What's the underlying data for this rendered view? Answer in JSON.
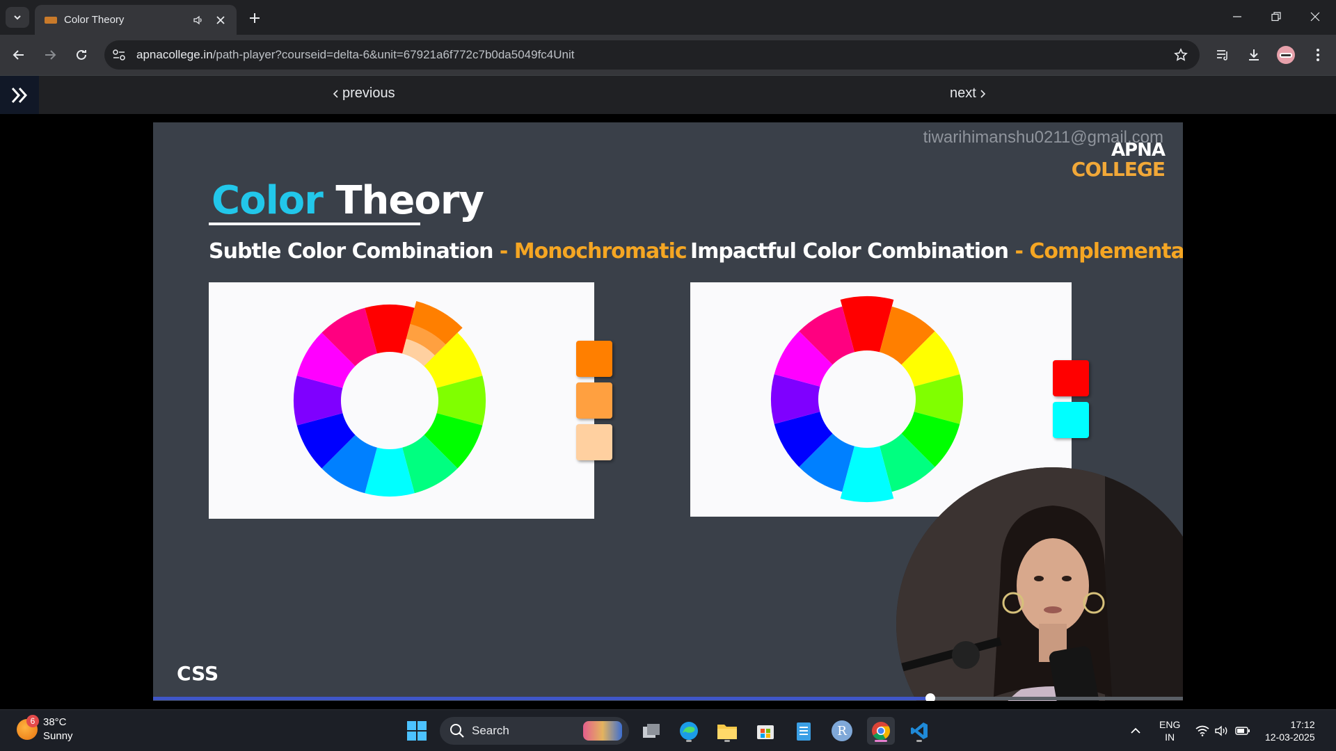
{
  "browser": {
    "tab": {
      "title": "Color Theory"
    },
    "address": {
      "host": "apnacollege.in",
      "path": "/path-player?courseid=delta-6&unit=67921a6f772c7b0da5049fc4Unit"
    },
    "icons": [
      "tab-search-icon",
      "speaker-icon",
      "close-icon",
      "plus-icon",
      "minimize-icon",
      "restore-icon",
      "back-icon",
      "forward-icon",
      "reload-icon",
      "site-info-icon",
      "star-icon",
      "reading-list-icon",
      "download-icon",
      "profile-icon",
      "menu-icon"
    ]
  },
  "page": {
    "previous_label": "previous",
    "next_label": "next"
  },
  "video": {
    "watermark": "tiwarihimanshu0211@gmail.com",
    "logo_line1": "APNA",
    "logo_line2": "COLLEGE",
    "title_part1": "Color",
    "title_part2": "Theory",
    "left_heading": "Subtle Color Combination",
    "left_heading_sep": " - ",
    "left_heading_accent": "Monochromatic",
    "right_heading": "Impactful Color Combination",
    "right_heading_sep": " - ",
    "right_heading_accent": "Complementary",
    "corner_label": "CSS",
    "progress_fraction": 0.755,
    "colors": {
      "wheel": [
        "#ff0000",
        "#ff7f00",
        "#ffff00",
        "#80ff00",
        "#00ff00",
        "#00ff80",
        "#00ffff",
        "#0080ff",
        "#0000ff",
        "#7f00ff",
        "#ff00ff",
        "#ff0080"
      ],
      "mono_swatches": [
        "#ff7f00",
        "#ffa040",
        "#ffd0a0"
      ],
      "comp_swatches": [
        "#ff0000",
        "#00ffff"
      ],
      "title_accent": "#22c7ea",
      "heading_accent": "#f5a623"
    }
  },
  "taskbar": {
    "weather_temp": "38°C",
    "weather_desc": "Sunny",
    "weather_badge": "6",
    "search_label": "Search",
    "lang_line1": "ENG",
    "lang_line2": "IN",
    "time": "17:12",
    "date": "12-03-2025",
    "apps": [
      "windows-start-icon",
      "task-view-icon",
      "edge-icon",
      "file-explorer-icon",
      "store-icon",
      "notepad-icon",
      "r-app-icon",
      "chrome-icon",
      "vscode-icon"
    ]
  }
}
